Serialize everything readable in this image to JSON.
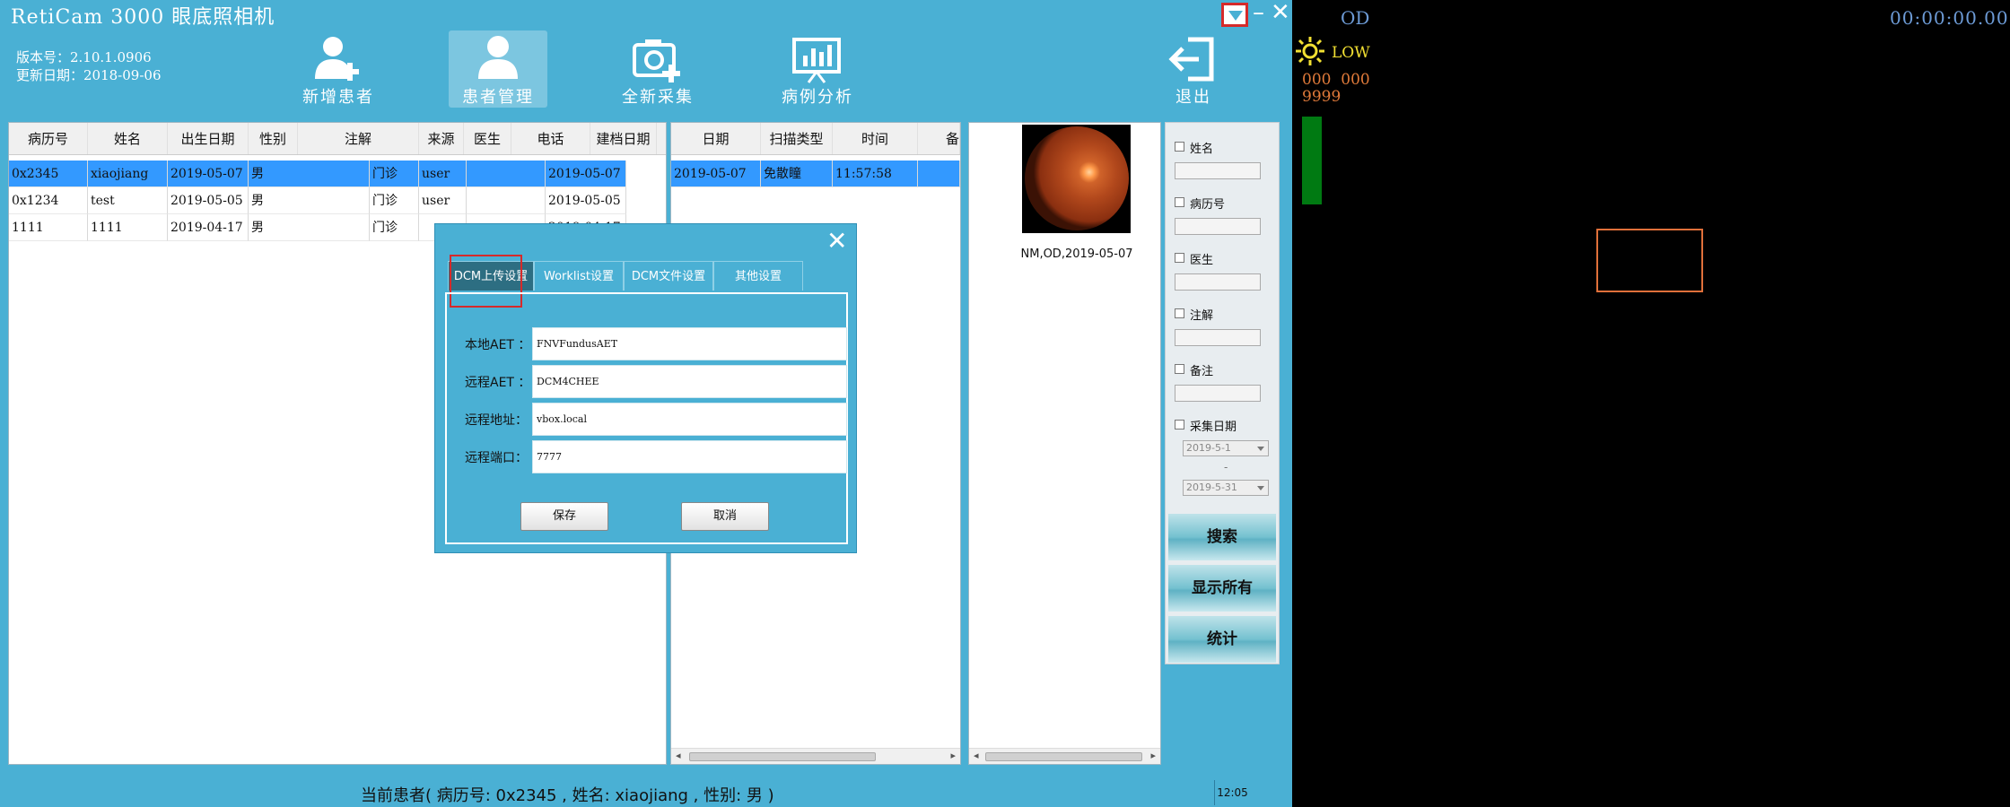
{
  "app": {
    "title": "RetiCam 3000 眼底照相机",
    "version_line": "版本号：2.10.1.0906",
    "update_line": "更新日期：2018-09-06"
  },
  "nav": {
    "new_patient": "新增患者",
    "patient_mgmt": "患者管理",
    "new_capture": "全新采集",
    "case_analysis": "病例分析",
    "exit": "退出"
  },
  "patients": {
    "headers": [
      "病历号",
      "姓名",
      "出生日期",
      "性别",
      "注解",
      "来源",
      "医生",
      "电话",
      "建档日期"
    ],
    "rows": [
      [
        "0x2345",
        "xiaojiang",
        "2019-05-07",
        "男",
        "",
        "门诊",
        "user",
        "",
        "2019-05-07"
      ],
      [
        "0x1234",
        "test",
        "2019-05-05",
        "男",
        "",
        "门诊",
        "user",
        "",
        "2019-05-05"
      ],
      [
        "1111",
        "1111",
        "2019-04-17",
        "男",
        "",
        "门诊",
        "",
        "",
        "2019-04-17"
      ]
    ],
    "selected_row": 0
  },
  "scans": {
    "headers": [
      "日期",
      "扫描类型",
      "时间",
      "备"
    ],
    "rows": [
      [
        "2019-05-07",
        "免散瞳",
        "11:57:58",
        ""
      ]
    ]
  },
  "image_panel": {
    "caption": "NM,OD,2019-05-07"
  },
  "search": {
    "filters": [
      "姓名",
      "病历号",
      "医生",
      "注解",
      "备注"
    ],
    "date_filter": "采集日期",
    "date_from": "2019-5-1",
    "date_sep": "-",
    "date_to": "2019-5-31",
    "search_btn": "搜索",
    "show_all_btn": "显示所有",
    "stats_btn": "统计"
  },
  "status": {
    "current_patient": "当前患者( 病历号: 0x2345 , 姓名: xiaojiang , 性别: 男 )",
    "clock": "12:05"
  },
  "dialog": {
    "tabs": [
      "DCM上传设置",
      "Worklist设置",
      "DCM文件设置",
      "其他设置"
    ],
    "active_tab": 0,
    "fields": [
      {
        "label": "本地AET ：",
        "value": "FNVFundusAET"
      },
      {
        "label": "远程AET ：",
        "value": "DCM4CHEE"
      },
      {
        "label": "远程地址：",
        "value": "vbox.local"
      },
      {
        "label": "远程端口：",
        "value": "7777"
      }
    ],
    "save_btn": "保存",
    "cancel_btn": "取消"
  },
  "camera": {
    "eye": "OD",
    "timer": "00:00:00.00",
    "brightness": "LOW",
    "readout": "000  000\n9999",
    "colors": {
      "readout": "#e07a3a",
      "timer": "#6d9bd6",
      "brightness": "#f2e032"
    }
  }
}
